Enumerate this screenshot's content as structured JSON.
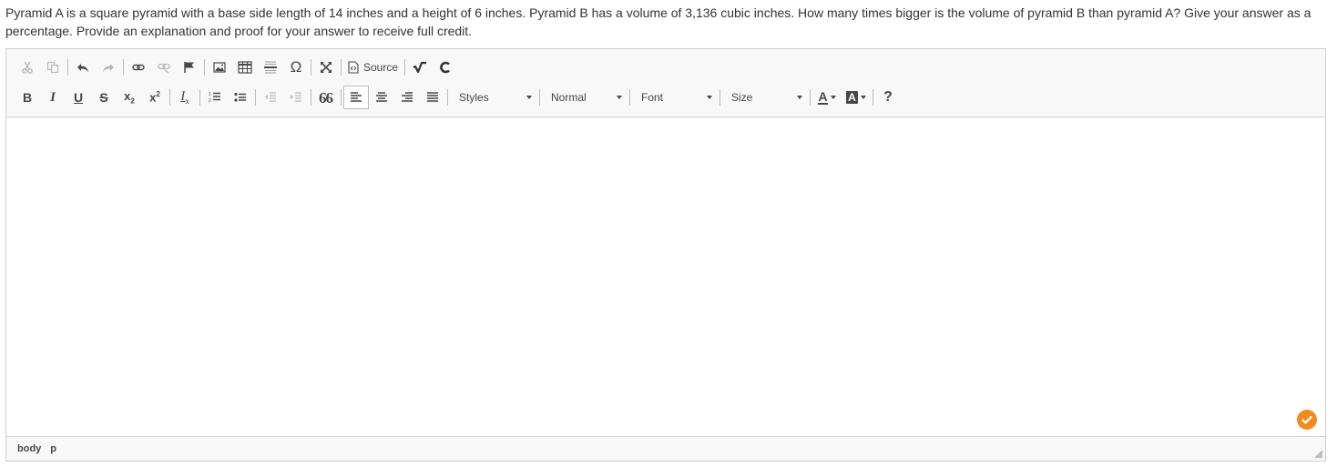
{
  "question": {
    "text": "Pyramid A is a square pyramid with a base side length of 14 inches and a height of 6 inches. Pyramid B has a volume of 3,136 cubic inches. How many times bigger is the volume of pyramid B than pyramid A? Give your answer as a percentage. Provide an explanation and proof for your answer to receive full credit."
  },
  "toolbar": {
    "row1": {
      "icons": [
        "cut-icon",
        "copy-icon",
        "undo-icon",
        "redo-icon",
        "link-icon",
        "unlink-icon",
        "anchor-flag-icon",
        "image-icon",
        "table-icon",
        "horizontal-line-icon",
        "special-char-icon",
        "maximize-icon",
        "source-icon",
        "math-icon",
        "chemistry-icon"
      ],
      "special_char_glyph": "Ω",
      "source_label": "Source"
    },
    "row2": {
      "icons": [
        "bold-icon",
        "italic-icon",
        "underline-icon",
        "strikethrough-icon",
        "subscript-icon",
        "superscript-icon",
        "remove-format-icon",
        "numbered-list-icon",
        "bulleted-list-icon",
        "outdent-icon",
        "indent-icon",
        "blockquote-icon",
        "align-left-icon",
        "align-center-icon",
        "align-right-icon",
        "justify-icon",
        "text-color-icon",
        "background-color-icon",
        "help-icon"
      ],
      "bold_glyph": "B",
      "italic_glyph": "I",
      "underline_glyph": "U",
      "strike_glyph": "S",
      "subscript_glyph": "x",
      "subscript_sub": "2",
      "superscript_glyph": "x",
      "superscript_sup": "2",
      "remove_format_glyph": "I",
      "remove_format_sub": "x",
      "quote_glyph": "99",
      "text_color_glyph": "A",
      "bg_color_glyph": "A",
      "help_glyph": "?",
      "styles_label": "Styles",
      "format_label": "Normal",
      "font_label": "Font",
      "size_label": "Size"
    }
  },
  "statusbar": {
    "path": [
      "body",
      "p"
    ]
  },
  "colors": {
    "accent_badge": "#f08c1f",
    "toolbar_bg": "#f8f8f8",
    "border": "#d1d1d1"
  }
}
